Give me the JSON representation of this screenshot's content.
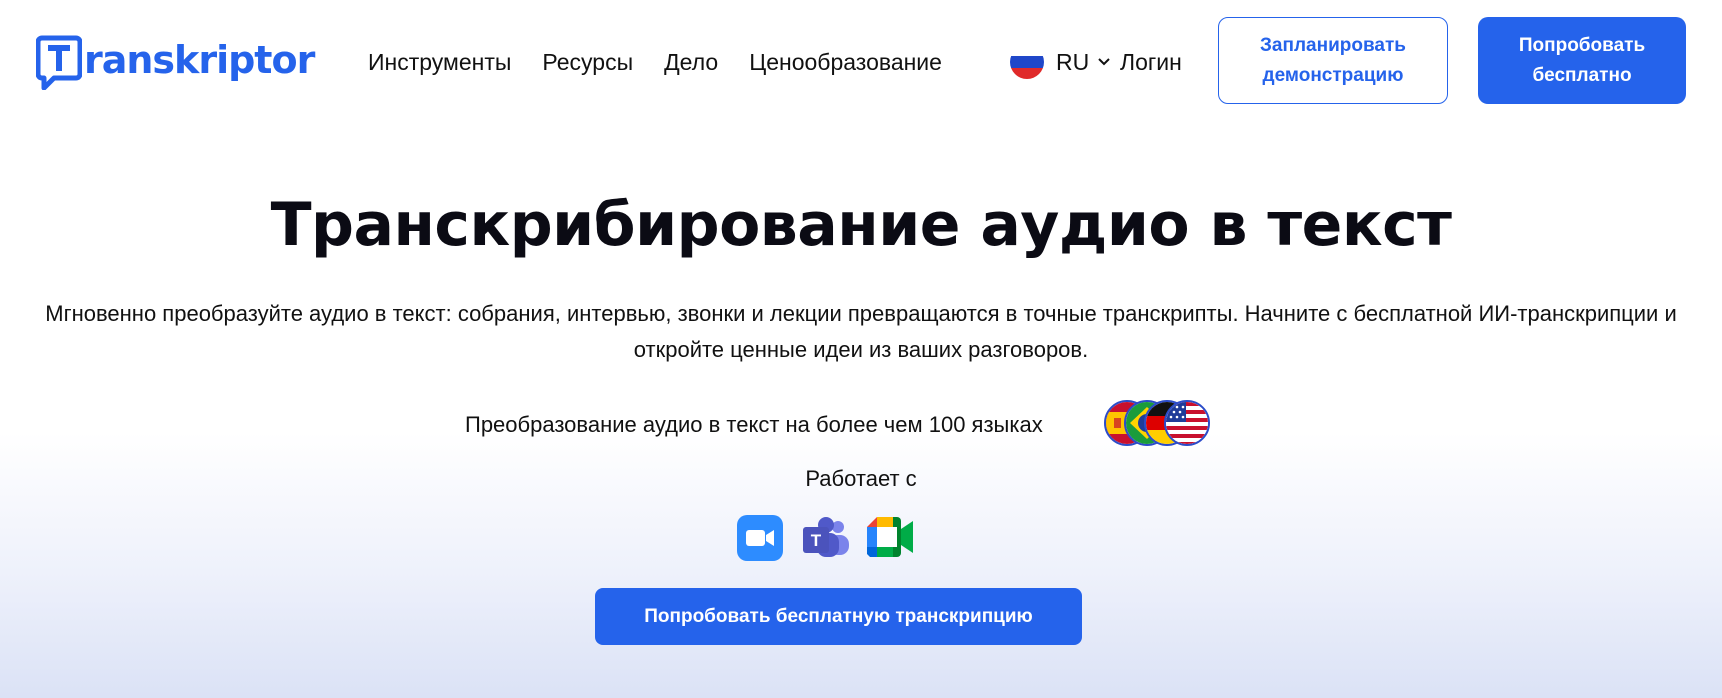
{
  "brand": {
    "name": "Transkriptor",
    "logo_letter": "T",
    "color": "#2563eb"
  },
  "nav": {
    "items": [
      {
        "label": "Инструменты"
      },
      {
        "label": "Ресурсы"
      },
      {
        "label": "Дело"
      },
      {
        "label": "Ценообразование"
      }
    ],
    "language": {
      "code": "RU",
      "flag_icon": "russia-flag-icon"
    },
    "login_label": "Логин",
    "demo_button_label": "Запланировать демонстрацию",
    "try_free_label": "Попробовать бесплатно"
  },
  "hero": {
    "title": "Транскрибирование аудио в текст",
    "subtitle": "Мгновенно преобразуйте аудио в текст: собрания, интервью, звонки и лекции превращаются в точные транскрипты. Начните с бесплатной ИИ-транскрипции и откройте ценные идеи из ваших разговоров.",
    "languages_text": "Преобразование аудио в текст на более чем 100 языках",
    "language_flags": [
      "spain-flag-icon",
      "brazil-flag-icon",
      "germany-flag-icon",
      "usa-flag-icon"
    ],
    "works_with_label": "Работает с",
    "integrations": [
      "zoom-icon",
      "microsoft-teams-icon",
      "google-meet-icon"
    ],
    "cta_label": "Попробовать бесплатную транскрипцию"
  },
  "colors": {
    "accent": "#2563eb",
    "text": "#111111",
    "background_gradient_end": "#dbe2f6"
  }
}
